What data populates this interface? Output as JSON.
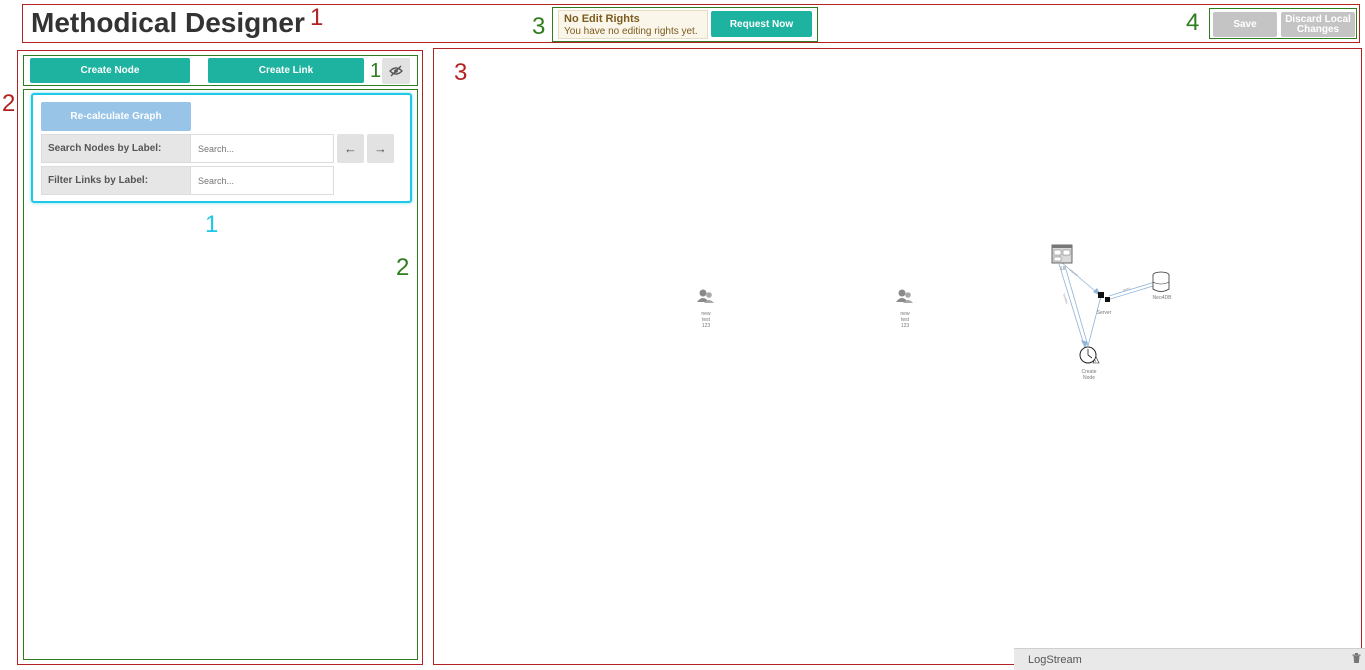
{
  "header": {
    "title": "Methodical Designer",
    "notice": {
      "title": "No Edit Rights",
      "text": "You have no editing rights yet."
    },
    "request_label": "Request Now",
    "save_label": "Save",
    "discard_label": "Discard Local Changes"
  },
  "sidebar": {
    "create_node_label": "Create Node",
    "create_link_label": "Create Link",
    "visibility_icon": "eye-off-icon",
    "recalc_label": "Re-calculate Graph",
    "search_nodes_label": "Search Nodes by Label:",
    "search_nodes_placeholder": "Search...",
    "filter_links_label": "Filter Links by Label:",
    "filter_links_placeholder": "Search...",
    "prev_icon": "←",
    "next_icon": "→"
  },
  "graph": {
    "nodes": [
      {
        "label_lines": [
          "new",
          "test",
          "123"
        ],
        "icon": "users-icon"
      },
      {
        "label_lines": [
          "new",
          "test",
          "123"
        ],
        "icon": "users-icon"
      },
      {
        "label": "UI",
        "icon": "window-icon"
      },
      {
        "label": "Server",
        "icon": "server-icon"
      },
      {
        "label": "Neo4DB",
        "icon": "database-icon"
      },
      {
        "label_lines": [
          "Create",
          "Node"
        ],
        "icon": "clock-warning-icon"
      }
    ]
  },
  "logstream": {
    "label": "LogStream",
    "icon": "trash-icon"
  },
  "annotations": [
    "1",
    "3",
    "4",
    "1",
    "2",
    "2",
    "1",
    "3"
  ],
  "colors": {
    "teal": "#1eb3a0",
    "annotation_red": "#b22222",
    "annotation_green": "#2e7d1f",
    "annotation_cyan": "#1ec8e6"
  }
}
